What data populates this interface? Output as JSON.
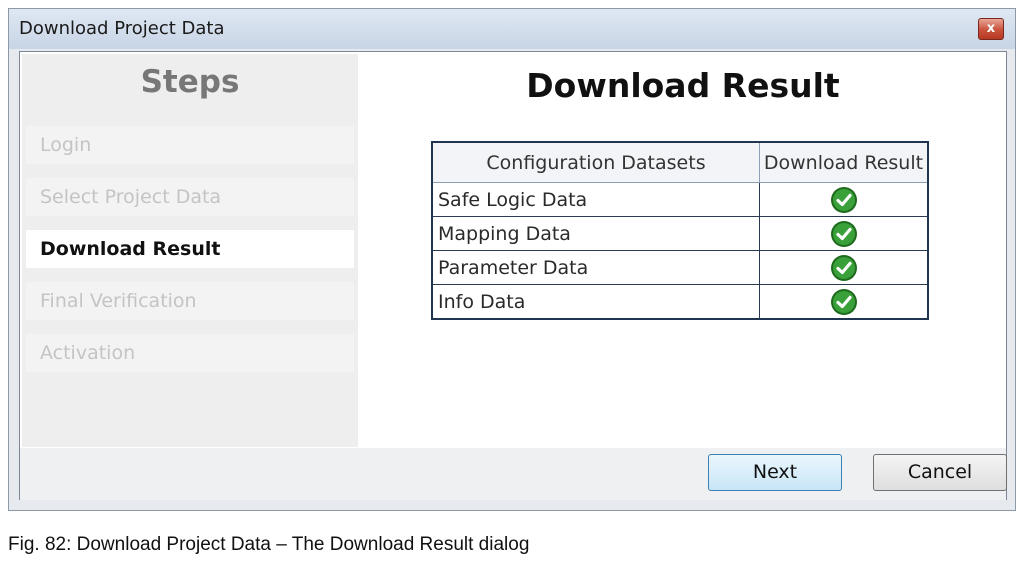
{
  "window": {
    "title": "Download Project Data",
    "close_glyph": "x"
  },
  "sidebar": {
    "title": "Steps",
    "items": [
      {
        "label": "Login",
        "state": "inactive"
      },
      {
        "label": "Select Project Data",
        "state": "inactive"
      },
      {
        "label": "Download Result",
        "state": "active"
      },
      {
        "label": "Final Verification",
        "state": "inactive"
      },
      {
        "label": "Activation",
        "state": "inactive"
      }
    ]
  },
  "main": {
    "title": "Download Result",
    "table": {
      "headers": [
        "Configuration Datasets",
        "Download Result"
      ],
      "rows": [
        {
          "dataset": "Safe Logic Data",
          "result_icon": "check-circle-icon"
        },
        {
          "dataset": "Mapping Data",
          "result_icon": "check-circle-icon"
        },
        {
          "dataset": "Parameter Data",
          "result_icon": "check-circle-icon"
        },
        {
          "dataset": "Info Data",
          "result_icon": "check-circle-icon"
        }
      ]
    }
  },
  "footer": {
    "next_label": "Next",
    "cancel_label": "Cancel"
  },
  "caption": "Fig. 82: Download Project Data – The Download Result dialog",
  "colors": {
    "success_green": "#2e8b2e",
    "active_step_text": "#111111",
    "inactive_step_text": "#c4c4c4"
  }
}
